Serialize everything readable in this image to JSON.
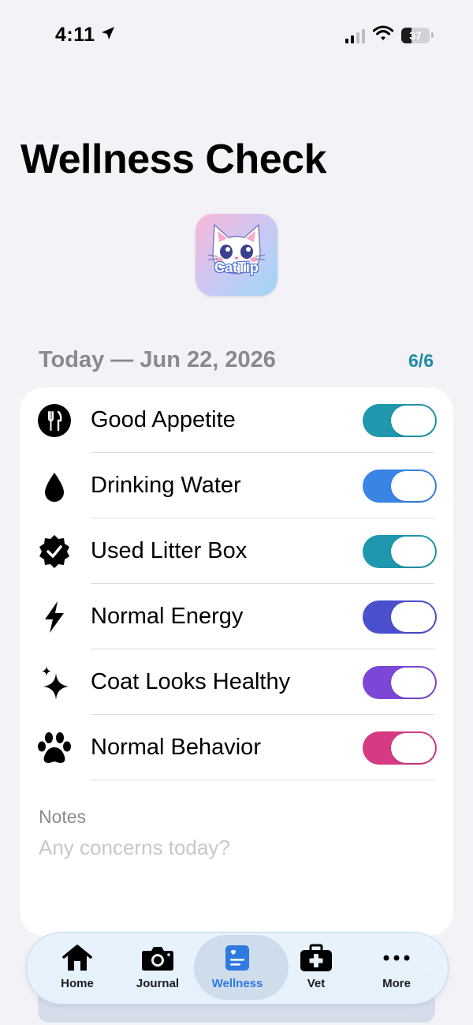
{
  "status_bar": {
    "time": "4:11",
    "battery": "37"
  },
  "page": {
    "title": "Wellness Check"
  },
  "app_icon": {
    "brand": "CatTip"
  },
  "section": {
    "date": "Today — Jun 22, 2026",
    "count": "6/6"
  },
  "checks": [
    {
      "label": "Good Appetite",
      "icon": "fork-knife-icon",
      "on": true,
      "color": "#1f97ad"
    },
    {
      "label": "Drinking Water",
      "icon": "water-drop-icon",
      "on": true,
      "color": "#3a84e3"
    },
    {
      "label": "Used Litter Box",
      "icon": "check-seal-icon",
      "on": true,
      "color": "#1f97ad"
    },
    {
      "label": "Normal Energy",
      "icon": "bolt-icon",
      "on": true,
      "color": "#4b4fcd"
    },
    {
      "label": "Coat Looks Healthy",
      "icon": "sparkles-icon",
      "on": true,
      "color": "#7c47d6"
    },
    {
      "label": "Normal Behavior",
      "icon": "paw-icon",
      "on": true,
      "color": "#d63a83"
    }
  ],
  "notes": {
    "label": "Notes",
    "placeholder": "Any concerns today?"
  },
  "tabbar": {
    "active": "Wellness",
    "accent": "#2f7ae0",
    "items": [
      {
        "label": "Home",
        "icon": "house-icon"
      },
      {
        "label": "Journal",
        "icon": "camera-icon"
      },
      {
        "label": "Wellness",
        "icon": "wellness-clipboard-icon"
      },
      {
        "label": "Vet",
        "icon": "medical-kit-icon"
      },
      {
        "label": "More",
        "icon": "ellipsis-icon"
      }
    ]
  }
}
